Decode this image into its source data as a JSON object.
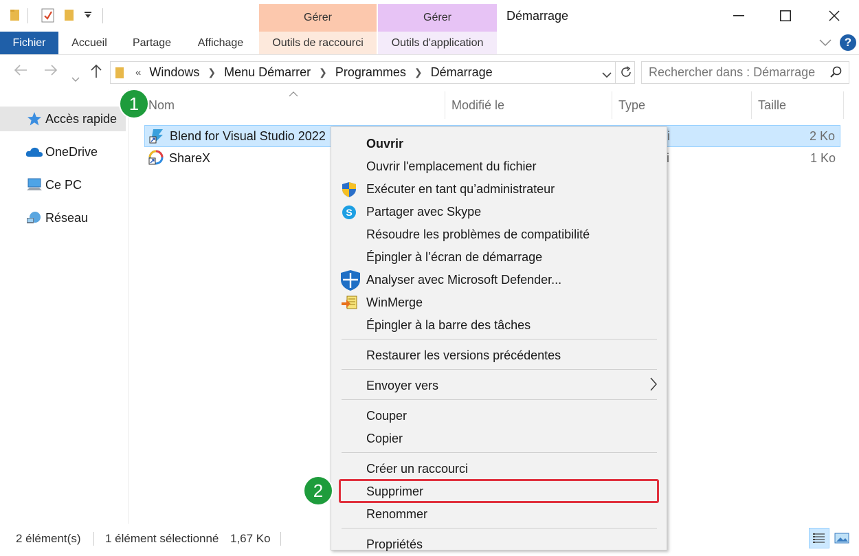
{
  "window": {
    "title": "Démarrage",
    "context_tab_heads": [
      "Gérer",
      "Gérer"
    ],
    "help_label": "?"
  },
  "ribbon": {
    "tabs": [
      "Fichier",
      "Accueil",
      "Partage",
      "Affichage",
      "Outils de raccourci",
      "Outils d'application"
    ]
  },
  "address": {
    "overflow": "«",
    "crumbs": [
      "Windows",
      "Menu Démarrer",
      "Programmes",
      "Démarrage"
    ],
    "search_placeholder": "Rechercher dans : Démarrage"
  },
  "nav": {
    "items": [
      "Accès rapide",
      "OneDrive",
      "Ce PC",
      "Réseau"
    ]
  },
  "columns": {
    "name": "Nom",
    "modified": "Modifié le",
    "type": "Type",
    "size": "Taille"
  },
  "files": [
    {
      "name": "Blend for Visual Studio 2022",
      "size": "2 Ko",
      "type_fragment": "i"
    },
    {
      "name": "ShareX",
      "size": "1 Ko",
      "type_fragment": "i"
    }
  ],
  "context_menu": {
    "items": [
      "Ouvrir",
      "Ouvrir l'emplacement du fichier",
      "Exécuter en tant qu’administrateur",
      "Partager avec Skype",
      "Résoudre les problèmes de compatibilité",
      "Épingler à l’écran de démarrage",
      "Analyser avec Microsoft Defender...",
      "WinMerge",
      "Épingler à la barre des tâches",
      "Restaurer les versions précédentes",
      "Envoyer vers",
      "Couper",
      "Copier",
      "Créer un raccourci",
      "Supprimer",
      "Renommer",
      "Propriétés"
    ]
  },
  "annotations": {
    "step1": "1",
    "step2": "2"
  },
  "status": {
    "count": "2 élément(s)",
    "selection": "1 élément sélectionné",
    "size": "1,67 Ko"
  },
  "colors": {
    "file_tab": "#1f5fa8",
    "selection": "#cce8ff",
    "badge": "#1e9c3c",
    "highlight": "#e0313e"
  }
}
